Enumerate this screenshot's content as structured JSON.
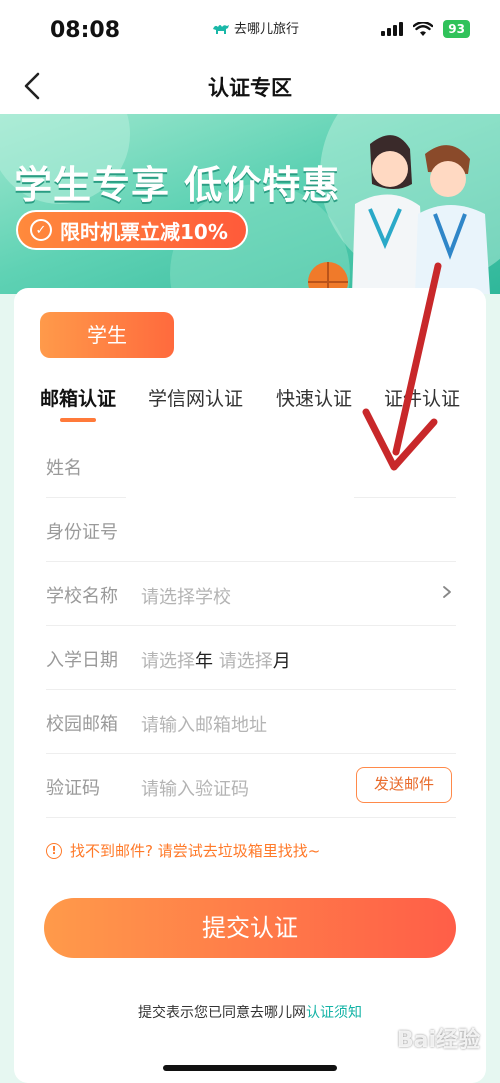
{
  "status_bar": {
    "time": "08:08",
    "app_name": "去哪儿旅行",
    "battery": "93"
  },
  "nav": {
    "title": "认证专区"
  },
  "banner": {
    "title": "学生专享 低价特惠",
    "promo": "限时机票立减10%"
  },
  "role_tag": "学生",
  "tabs": [
    {
      "label": "邮箱认证",
      "active": true
    },
    {
      "label": "学信网认证",
      "active": false
    },
    {
      "label": "快速认证",
      "active": false
    },
    {
      "label": "证件认证",
      "active": false
    }
  ],
  "form": {
    "name_label": "姓名",
    "id_label": "身份证号",
    "school_label": "学校名称",
    "school_placeholder": "请选择学校",
    "enroll_label": "入学日期",
    "year_placeholder": "请选择",
    "year_unit": "年",
    "month_placeholder": "请选择",
    "month_unit": "月",
    "email_label": "校园邮箱",
    "email_placeholder": "请输入邮箱地址",
    "code_label": "验证码",
    "code_placeholder": "请输入验证码",
    "send_button": "发送邮件"
  },
  "tip": "找不到邮件? 请尝试去垃圾箱里找找~",
  "submit_button": "提交认证",
  "agreement": {
    "prefix": "提交表示您已同意去哪儿网",
    "link": "认证须知"
  },
  "watermark": "Bai经验",
  "colors": {
    "accent_orange": "#ff7a3a",
    "teal_link": "#14b3a6",
    "banner_green": "#5fd2b4"
  }
}
